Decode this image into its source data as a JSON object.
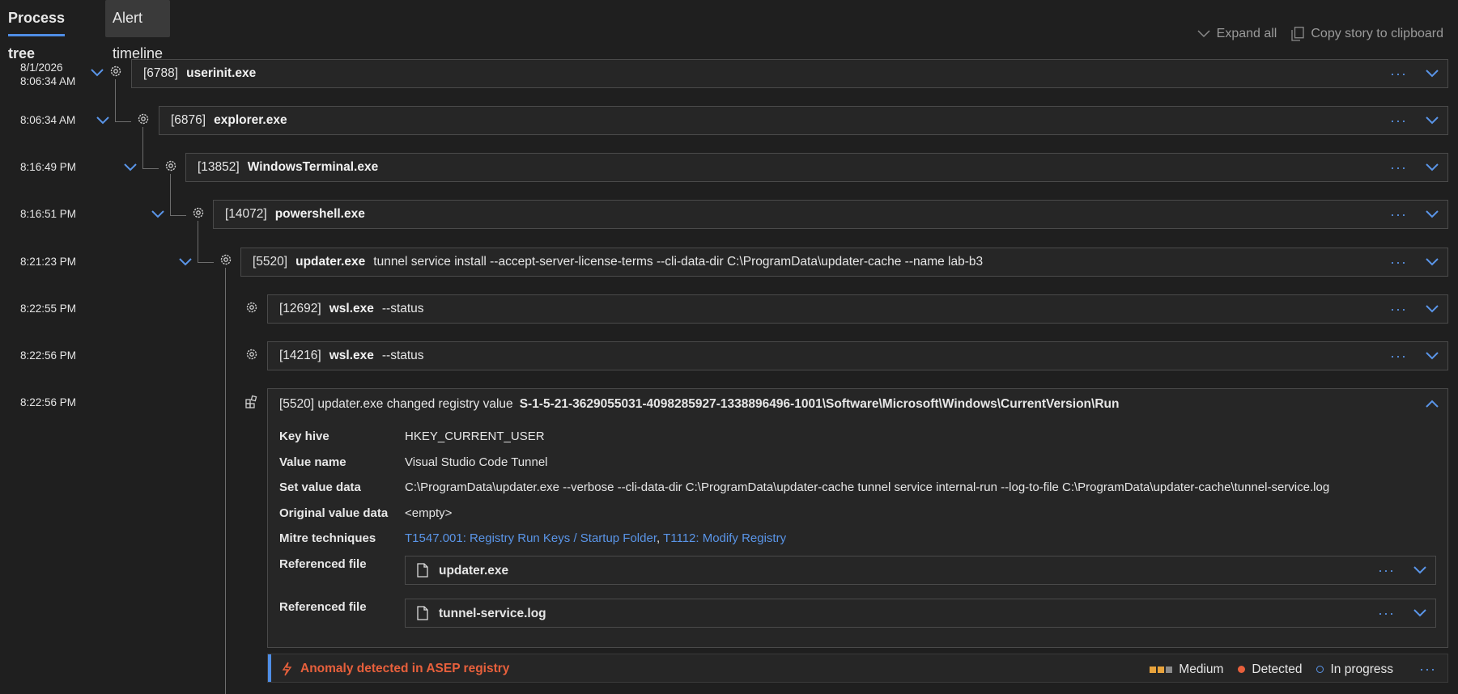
{
  "tabs": {
    "process_tree": "Process tree",
    "alert_timeline": "Alert timeline"
  },
  "toolbar": {
    "expand_all": "Expand all",
    "copy_story": "Copy story to clipboard"
  },
  "timestamps": [
    {
      "date": "8/1/2026",
      "time": "8:06:34 AM"
    },
    {
      "time": "8:06:34 AM"
    },
    {
      "time": "8:16:49 PM"
    },
    {
      "time": "8:16:51 PM"
    },
    {
      "time": "8:21:23 PM"
    },
    {
      "time": "8:22:55 PM"
    },
    {
      "time": "8:22:56 PM"
    },
    {
      "time": "8:22:56 PM"
    }
  ],
  "processes": [
    {
      "pid": "[6788]",
      "name": "userinit.exe",
      "args": ""
    },
    {
      "pid": "[6876]",
      "name": "explorer.exe",
      "args": ""
    },
    {
      "pid": "[13852]",
      "name": "WindowsTerminal.exe",
      "args": ""
    },
    {
      "pid": "[14072]",
      "name": "powershell.exe",
      "args": ""
    },
    {
      "pid": "[5520]",
      "name": "updater.exe",
      "args": "tunnel service install --accept-server-license-terms --cli-data-dir C:\\ProgramData\\updater-cache --name lab-b3"
    },
    {
      "pid": "[12692]",
      "name": "wsl.exe",
      "args": "--status"
    },
    {
      "pid": "[14216]",
      "name": "wsl.exe",
      "args": "--status"
    }
  ],
  "registry_event": {
    "header": "[5520] updater.exe changed registry value",
    "path": "S-1-5-21-3629055031-4098285927-1338896496-1001\\Software\\Microsoft\\Windows\\CurrentVersion\\Run",
    "fields": {
      "key_hive_label": "Key hive",
      "key_hive": "HKEY_CURRENT_USER",
      "value_name_label": "Value name",
      "value_name": "Visual Studio Code Tunnel",
      "set_value_label": "Set value data",
      "set_value": "C:\\ProgramData\\updater.exe --verbose --cli-data-dir C:\\ProgramData\\updater-cache tunnel service internal-run --log-to-file C:\\ProgramData\\updater-cache\\tunnel-service.log",
      "original_value_label": "Original value data",
      "original_value": "<empty>",
      "mitre_label": "Mitre techniques",
      "mitre_1": "T1547.001: Registry Run Keys / Startup Folder",
      "mitre_sep": ", ",
      "mitre_2": "T1112: Modify Registry",
      "ref_label": "Referenced file"
    },
    "files": [
      "updater.exe",
      "tunnel-service.log"
    ]
  },
  "alert": {
    "title": "Anomaly detected in ASEP registry",
    "severity": "Medium",
    "detection": "Detected",
    "status": "In progress"
  },
  "colors": {
    "accent": "#4f8ee6",
    "link": "#5a95e8",
    "alert": "#e8603c",
    "severity": "#e8a33c"
  }
}
